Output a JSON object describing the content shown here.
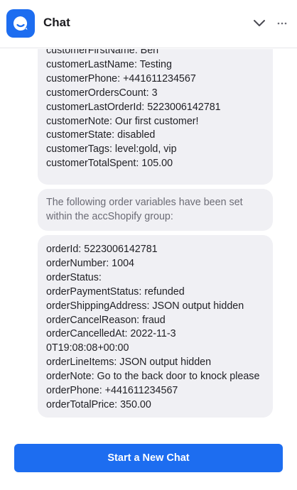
{
  "header": {
    "title": "Chat"
  },
  "messages": [
    {
      "lines": [
        "customerFirstName: Ben",
        "customerLastName: Testing",
        "customerPhone: +441611234567",
        "customerOrdersCount: 3",
        "customerLastOrderId: 5223006142781",
        "customerNote: Our first customer!",
        "customerState: disabled",
        "customerTags: level:gold, vip",
        "customerTotalSpent: 105.00"
      ]
    },
    {
      "text": "The following order variables have been set within the accShopify group:"
    },
    {
      "lines": [
        "orderId: 5223006142781",
        "orderNumber: 1004",
        "orderStatus:",
        "orderPaymentStatus: refunded",
        "orderShippingAddress: JSON output hidden",
        "orderCancelReason: fraud",
        "orderCancelledAt: 2022-11-30T19:08:08+00:00",
        "orderLineItems: JSON output hidden",
        "orderNote: Go to the back door to knock please",
        "orderPhone: +441611234567",
        "orderTotalPrice: 350.00"
      ]
    }
  ],
  "footer": {
    "button_label": "Start a New Chat"
  },
  "colors": {
    "accent": "#1d6df0",
    "bubble": "#f0f0f4"
  },
  "icons": {
    "logo": "chat-bubble-icon",
    "collapse": "chevron-down-icon",
    "menu": "more-icon"
  }
}
